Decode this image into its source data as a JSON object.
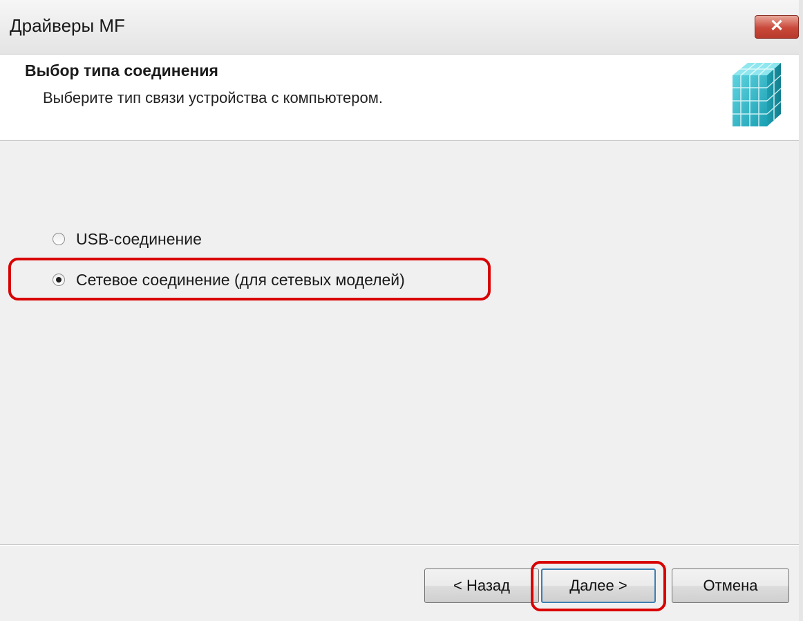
{
  "window": {
    "title": "Драйверы MF",
    "close_label": "✕"
  },
  "header": {
    "title": "Выбор типа соединения",
    "subtitle": "Выберите тип связи устройства с компьютером."
  },
  "options": [
    {
      "label": "USB-соединение",
      "checked": false
    },
    {
      "label": "Сетевое соединение (для сетевых моделей)",
      "checked": true
    }
  ],
  "buttons": {
    "back": "< Назад",
    "next": "Далее >",
    "cancel": "Отмена"
  },
  "colors": {
    "highlight": "#d90000",
    "logo_main": "#29b6c8"
  }
}
